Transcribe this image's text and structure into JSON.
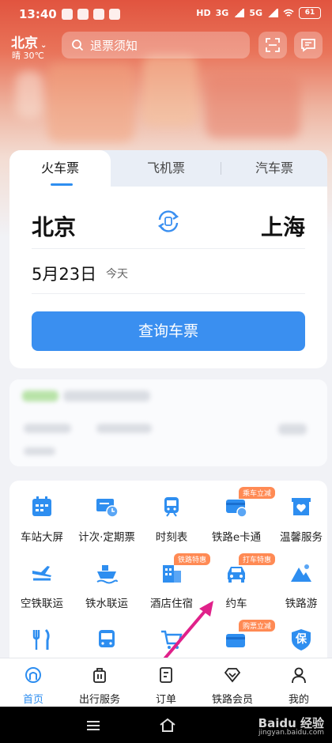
{
  "status_bar": {
    "time": "13:40",
    "app_badges": [
      "听",
      "听",
      "路"
    ],
    "net1": "HD",
    "net2": "3G",
    "net3": "5G",
    "battery": "61"
  },
  "header": {
    "city": "北京",
    "weather": "晴 30℃",
    "search_placeholder": "退票须知",
    "scan_icon": "scan-icon",
    "message_icon": "message-icon"
  },
  "ticket_tabs": [
    {
      "label": "火车票",
      "active": true
    },
    {
      "label": "飞机票",
      "active": false
    },
    {
      "label": "汽车票",
      "active": false
    }
  ],
  "ticket_form": {
    "from": "北京",
    "to": "上海",
    "date": "5月23日",
    "day": "今天",
    "query_button": "查询车票"
  },
  "services": [
    {
      "label": "车站大屏",
      "icon": "calendar-icon",
      "badge": ""
    },
    {
      "label": "计次·定期票",
      "icon": "ticket-icon",
      "badge": ""
    },
    {
      "label": "时刻表",
      "icon": "train-icon",
      "badge": ""
    },
    {
      "label": "铁路e卡通",
      "icon": "card-icon",
      "badge": "乘车立减"
    },
    {
      "label": "温馨服务",
      "icon": "heart-box-icon",
      "badge": ""
    },
    {
      "label": "空铁联运",
      "icon": "plane-icon",
      "badge": ""
    },
    {
      "label": "铁水联运",
      "icon": "ship-icon",
      "badge": ""
    },
    {
      "label": "酒店住宿",
      "icon": "hotel-icon",
      "badge": "铁路特惠"
    },
    {
      "label": "约车",
      "icon": "car-icon",
      "badge": "打车特惠"
    },
    {
      "label": "铁路游",
      "icon": "mountain-icon",
      "badge": ""
    },
    {
      "label": "",
      "icon": "food-icon",
      "badge": ""
    },
    {
      "label": "",
      "icon": "bus-icon",
      "badge": ""
    },
    {
      "label": "",
      "icon": "cart-icon",
      "badge": ""
    },
    {
      "label": "",
      "icon": "credit-icon",
      "badge": "购票立减"
    },
    {
      "label": "保",
      "icon": "shield-icon",
      "badge": ""
    }
  ],
  "bottom_nav": [
    {
      "label": "首页",
      "active": true
    },
    {
      "label": "出行服务",
      "active": false
    },
    {
      "label": "订单",
      "active": false
    },
    {
      "label": "铁路会员",
      "active": false
    },
    {
      "label": "我的",
      "active": false
    }
  ],
  "watermark": {
    "text": "Baidu 经验",
    "sub": "jingyan.baidu.com"
  },
  "colors": {
    "accent": "#2e8ef0",
    "button": "#3a8ff0",
    "badge": "#ff8a54",
    "hero": "#e1543f",
    "annotation_arrow": "#e0218a"
  }
}
